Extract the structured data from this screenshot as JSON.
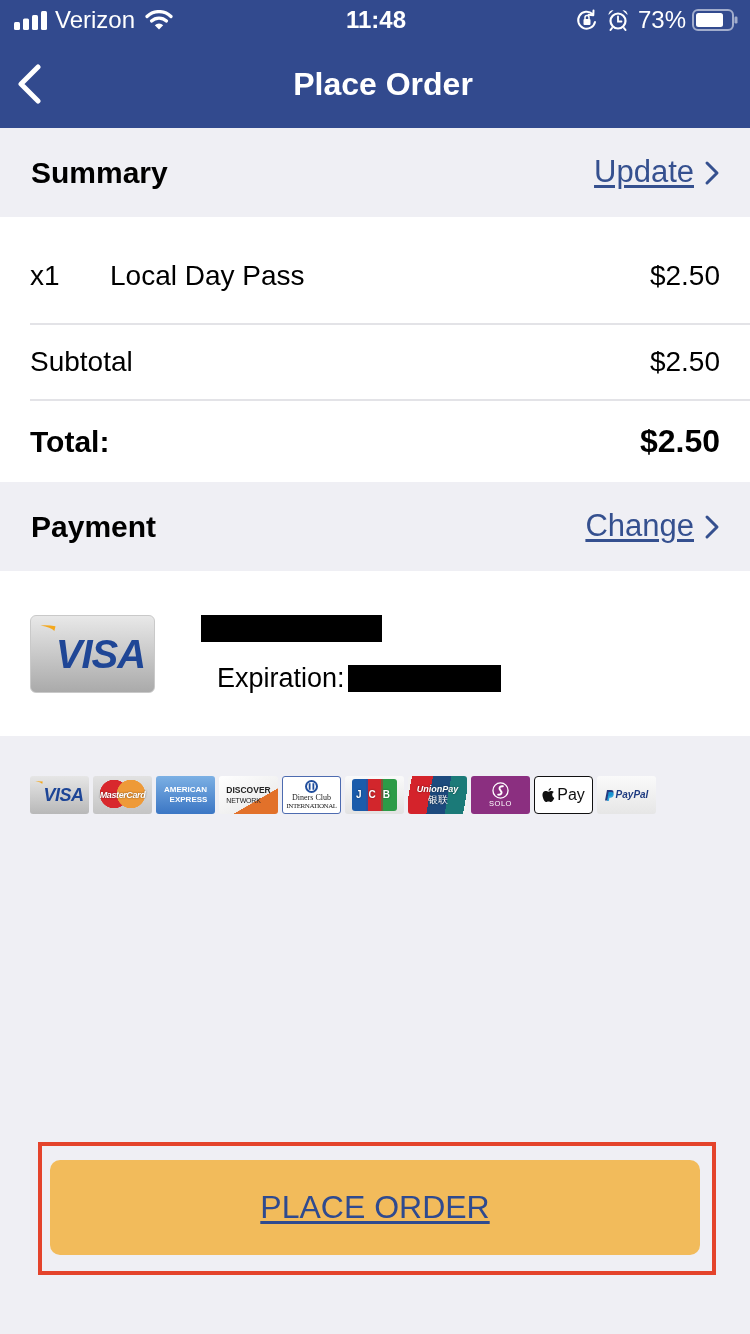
{
  "status_bar": {
    "carrier": "Verizon",
    "time": "11:48",
    "battery": "73%"
  },
  "nav": {
    "title": "Place Order"
  },
  "summary": {
    "title": "Summary",
    "action": "Update",
    "rows": [
      {
        "kind": "item",
        "quantity": "x1",
        "label": "Local Day Pass",
        "amount": "$2.50"
      },
      {
        "kind": "subtotal",
        "label": "Subtotal",
        "amount": "$2.50"
      },
      {
        "kind": "total",
        "label": "Total:",
        "amount": "$2.50"
      }
    ]
  },
  "payment": {
    "title": "Payment",
    "action": "Change",
    "card": {
      "kind": "visa",
      "brand": "VISA",
      "redacted": true,
      "expiration_label": "Expiration:"
    }
  },
  "accepted_cards": [
    {
      "kind": "visa",
      "text": [
        "VISA"
      ]
    },
    {
      "kind": "mastercard",
      "text": [
        "MasterCard"
      ]
    },
    {
      "kind": "amex",
      "text": [
        "AMERICAN",
        "EXPRESS"
      ]
    },
    {
      "kind": "discover",
      "text": [
        "DISCOVER",
        "NETWORK"
      ]
    },
    {
      "kind": "diners",
      "text": [
        "Diners Club",
        "INTERNATIONAL"
      ]
    },
    {
      "kind": "jcb",
      "text": [
        "JCB"
      ]
    },
    {
      "kind": "unionpay",
      "text": [
        "UnionPay",
        "银联"
      ]
    },
    {
      "kind": "solo",
      "text": [
        "SOLO"
      ]
    },
    {
      "kind": "applepay",
      "text": [
        "Pay"
      ]
    },
    {
      "kind": "paypal",
      "text": [
        "PayPal"
      ]
    }
  ],
  "place_order_button": {
    "label": "PLACE ORDER",
    "highlighted": true
  }
}
